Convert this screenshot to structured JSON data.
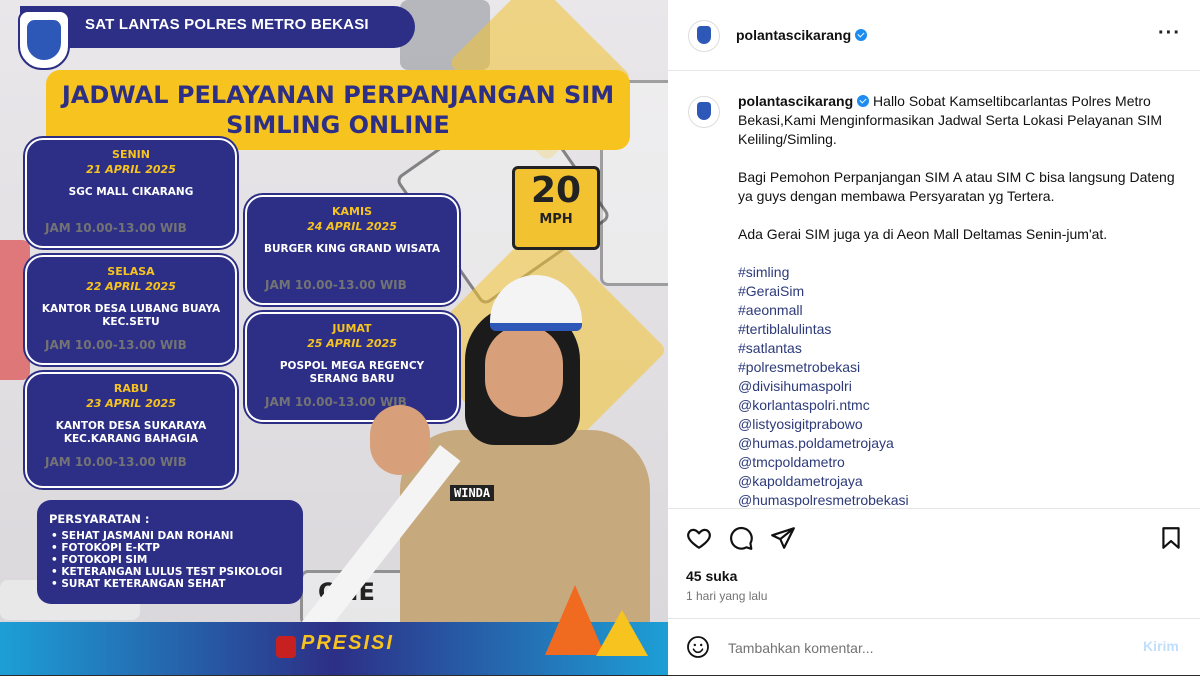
{
  "poster": {
    "header_title": "SAT LANTAS POLRES METRO BEKASI",
    "title_line1": "JADWAL PELAYANAN PERPANJANGAN SIM",
    "title_line2": "SIMLING ONLINE",
    "sign_speed": "20",
    "sign_unit": "MPH",
    "sign_one": "ONE",
    "schedule": [
      {
        "day": "SENIN",
        "date": "21 APRIL 2025",
        "time": "JAM 10.00-13.00 WIB",
        "location": "SGC MALL CIKARANG"
      },
      {
        "day": "SELASA",
        "date": "22 APRIL 2025",
        "time": "JAM 10.00-13.00 WIB",
        "location": "KANTOR DESA LUBANG BUAYA KEC.SETU"
      },
      {
        "day": "RABU",
        "date": "23 APRIL 2025",
        "time": "JAM 10.00-13.00 WIB",
        "location": "KANTOR DESA SUKARAYA KEC.KARANG BAHAGIA"
      },
      {
        "day": "KAMIS",
        "date": "24 APRIL 2025",
        "time": "JAM 10.00-13.00 WIB",
        "location": "BURGER KING GRAND WISATA"
      },
      {
        "day": "JUMAT",
        "date": "25 APRIL 2025",
        "time": "JAM 10.00-13.00 WIB",
        "location": "POSPOL MEGA REGENCY SERANG BARU"
      }
    ],
    "requirements_title": "PERSYARATAN :",
    "requirements": [
      "SEHAT JASMANI DAN ROHANI",
      "FOTOKOPI E-KTP",
      "FOTOKOPI SIM",
      "KETERANGAN LULUS TEST PSIKOLOGI",
      "SURAT KETERANGAN SEHAT"
    ],
    "officer_name": "WINDA",
    "footer_brand": "PRESISI"
  },
  "post": {
    "username": "polantascikarang",
    "caption_p1": "Hallo Sobat Kamseltibcarlantas Polres Metro Bekasi,Kami Menginformasikan Jadwal Serta Lokasi Pelayanan SIM Keliling/Simling.",
    "caption_p2": "Bagi Pemohon Perpanjangan SIM A atau SIM C bisa langsung Dateng ya guys dengan membawa Persyaratan yg Tertera.",
    "caption_p3": "Ada Gerai SIM juga ya di Aeon Mall Deltamas Senin-jum'at.",
    "tags": [
      "#simling",
      "#GeraiSim",
      "#aeonmall",
      "#tertiblalulintas",
      "#satlantas",
      "#polresmetrobekasi",
      "@divisihumaspolri",
      "@korlantaspolri.ntmc",
      "@listyosigitprabowo",
      "@humas.poldametrojaya",
      "@tmcpoldametro",
      "@kapoldametrojaya",
      "@humaspolresmetrobekasi"
    ],
    "likes": "45 suka",
    "time_ago": "1 hari yang lalu",
    "comment_placeholder": "Tambahkan komentar...",
    "post_button": "Kirim"
  },
  "colors": {
    "poster_navy": "#2d2f86",
    "poster_yellow": "#f7c31f",
    "verified_blue": "#1d8cf0",
    "post_button_disabled": "#c0dffd"
  },
  "icons": [
    "more-options-icon",
    "like-heart-icon",
    "comment-bubble-icon",
    "share-send-icon",
    "save-bookmark-icon",
    "emoji-icon",
    "verified-badge-icon"
  ]
}
